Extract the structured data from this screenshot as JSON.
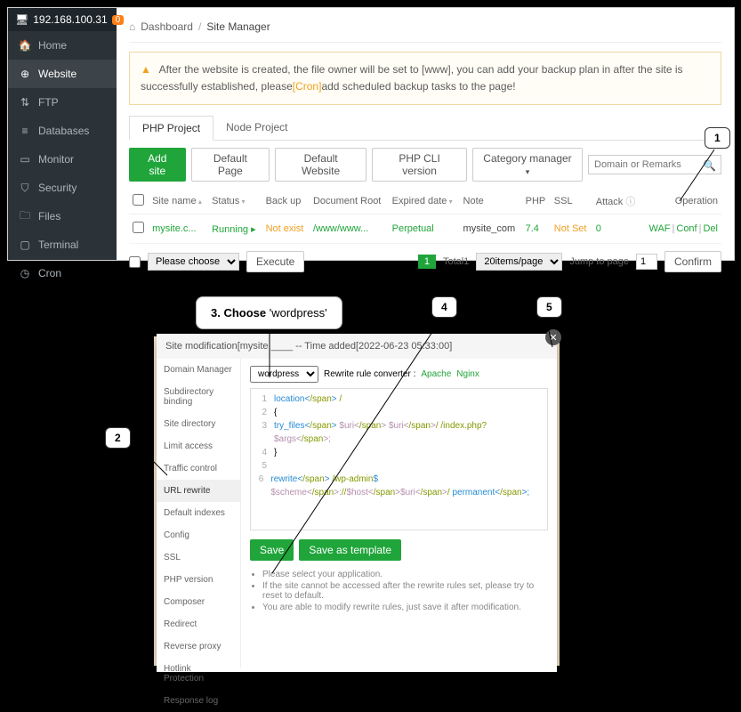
{
  "sidebar": {
    "ip": "192.168.100.31",
    "badge": "0",
    "items": [
      {
        "label": "Home",
        "icon": "home"
      },
      {
        "label": "Website",
        "icon": "globe",
        "active": true
      },
      {
        "label": "FTP",
        "icon": "ftp"
      },
      {
        "label": "Databases",
        "icon": "db"
      },
      {
        "label": "Monitor",
        "icon": "monitor"
      },
      {
        "label": "Security",
        "icon": "shield"
      },
      {
        "label": "Files",
        "icon": "folder"
      },
      {
        "label": "Terminal",
        "icon": "terminal"
      },
      {
        "label": "Cron",
        "icon": "clock"
      }
    ]
  },
  "breadcrumb": {
    "dashboard": "Dashboard",
    "current": "Site Manager"
  },
  "alert": {
    "text_before": "After the website is created, the file owner will be set to [www], you can add your backup plan in after the site is successfully established, please",
    "cron": "[Cron]",
    "text_after": "add scheduled backup tasks to the page!"
  },
  "tabs": {
    "php": "PHP Project",
    "node": "Node Project"
  },
  "toolbar": {
    "add": "Add site",
    "default_page": "Default Page",
    "default_website": "Default Website",
    "php_cli": "PHP CLI version",
    "category": "Category manager",
    "search_placeholder": "Domain or Remarks"
  },
  "table": {
    "headers": {
      "site_name": "Site name",
      "status": "Status",
      "backup": "Back up",
      "docroot": "Document Root",
      "expired": "Expired date",
      "note": "Note",
      "php": "PHP",
      "ssl": "SSL",
      "attack": "Attack",
      "operation": "Operation"
    },
    "rows": [
      {
        "site": "mysite.c...",
        "status": "Running",
        "backup": "Not exist",
        "docroot": "/www/www...",
        "expired": "Perpetual",
        "note": "mysite_com",
        "php": "7.4",
        "ssl": "Not Set",
        "attack": "0",
        "ops": {
          "waf": "WAF",
          "conf": "Conf",
          "del": "Del"
        }
      }
    ]
  },
  "footer": {
    "please_choose": "Please choose",
    "execute": "Execute",
    "page": "1",
    "total": "Total1",
    "perpage": "20items/page",
    "jump": "Jump to page",
    "jump_val": "1",
    "confirm": "Confirm"
  },
  "modal": {
    "title": "Site modification[mysite.____ -- Time added[2022-06-23 05:33:00]",
    "sidebar": [
      "Domain Manager",
      "Subdirectory binding",
      "Site directory",
      "Limit access",
      "Traffic control",
      "URL rewrite",
      "Default indexes",
      "Config",
      "SSL",
      "PHP version",
      "Composer",
      "Redirect",
      "Reverse proxy",
      "Hotlink Protection",
      "Response log"
    ],
    "active_index": 5,
    "dropdown_value": "wordpress",
    "converter_label": "Rewrite rule converter :",
    "apache": "Apache",
    "nginx": "Nginx",
    "code": [
      {
        "n": "1",
        "raw": "location /"
      },
      {
        "n": "2",
        "raw": "{"
      },
      {
        "n": "3",
        "raw": "  try_files $uri $uri/ /index.php?$args;"
      },
      {
        "n": "4",
        "raw": "}"
      },
      {
        "n": "5",
        "raw": ""
      },
      {
        "n": "6",
        "raw": "rewrite /wp-admin$ $scheme://$host$uri/ permanent;"
      }
    ],
    "save": "Save",
    "save_template": "Save as template",
    "hints": [
      "Please select your application.",
      "If the site cannot be accessed after the rewrite rules set, please try to reset to default.",
      "You are able to modify rewrite rules, just save it after modification."
    ]
  },
  "callouts": {
    "c1": "1",
    "c2": "2",
    "c3_label": "3. Choose",
    "c3_value": " 'wordpress'",
    "c4": "4",
    "c5": "5"
  }
}
